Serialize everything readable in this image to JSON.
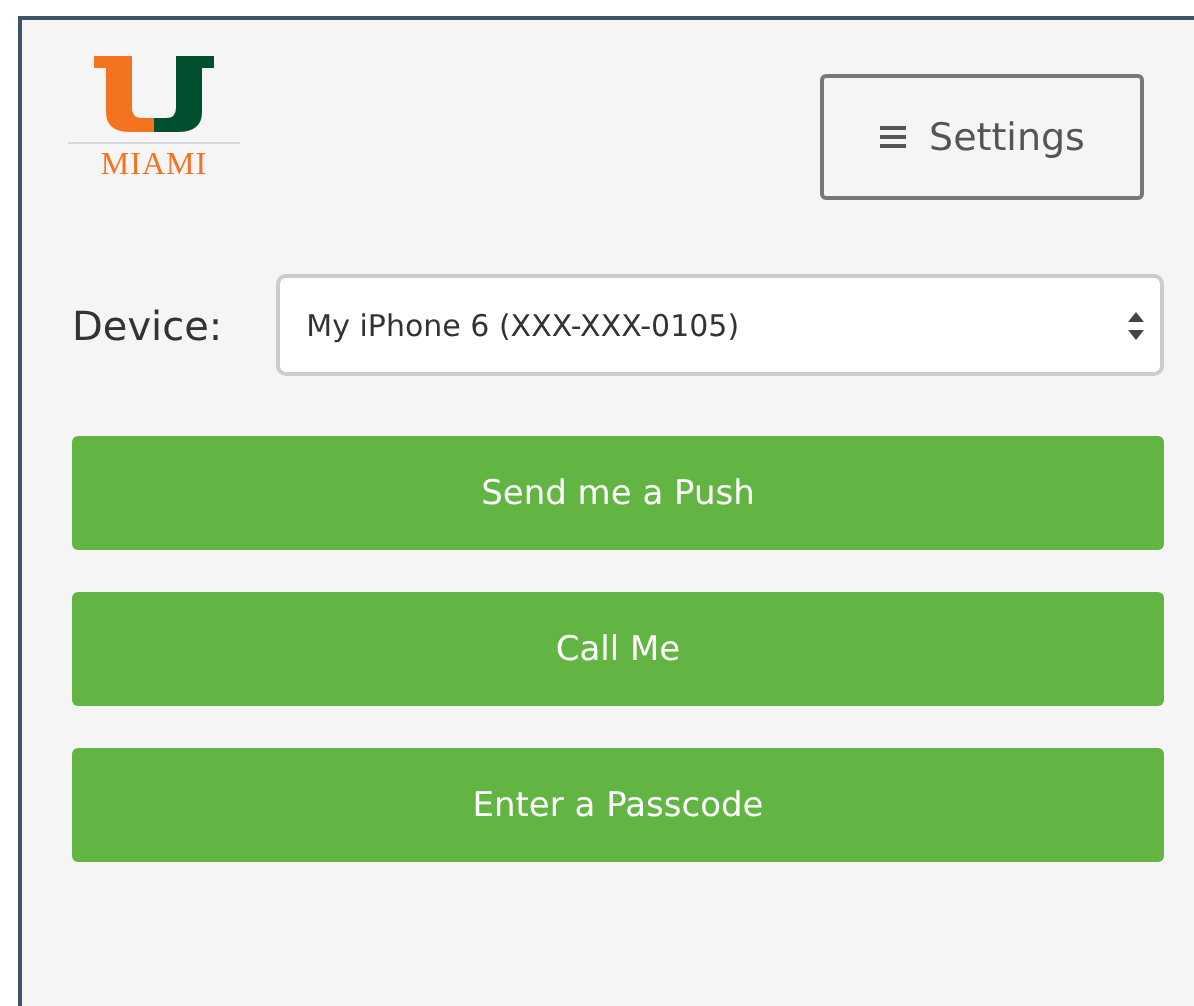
{
  "logo": {
    "text": "MIAMI"
  },
  "settings_button": {
    "label": "Settings"
  },
  "device": {
    "label": "Device:",
    "value": "My iPhone 6 (XXX-XXX-0105)"
  },
  "actions": [
    {
      "label": "Send me a Push"
    },
    {
      "label": "Call Me"
    },
    {
      "label": "Enter a Passcode"
    }
  ]
}
